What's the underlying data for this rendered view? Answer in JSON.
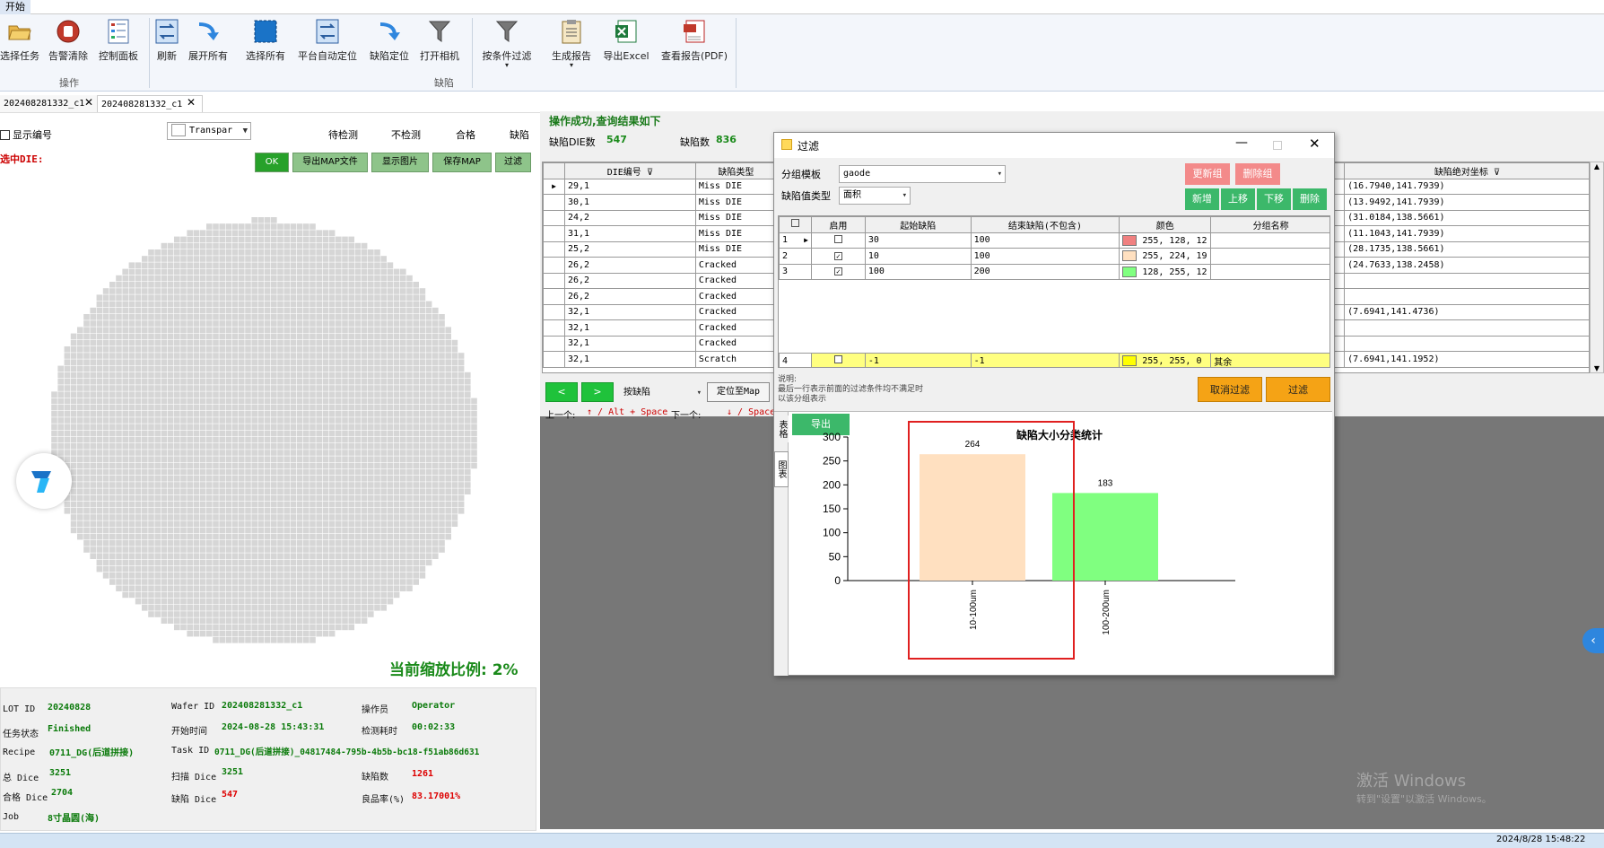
{
  "title_tab": "开始",
  "ribbon": {
    "buttons": [
      {
        "label": "选择任务",
        "icon": "folder-open-icon"
      },
      {
        "label": "告警清除",
        "icon": "stop-hand-icon"
      },
      {
        "label": "控制面板",
        "icon": "control-panel-icon"
      },
      {
        "label": "刷新",
        "icon": "refresh-icon"
      },
      {
        "label": "展开所有",
        "icon": "expand-arrow-icon"
      },
      {
        "label": "选择所有",
        "icon": "select-all-icon"
      },
      {
        "label": "平台自动定位",
        "icon": "auto-locate-icon"
      },
      {
        "label": "缺陷定位",
        "icon": "locate-arrow-icon"
      },
      {
        "label": "打开相机",
        "icon": "funnel-icon"
      },
      {
        "label": "按条件过滤",
        "icon": "filter-icon"
      },
      {
        "label": "生成报告",
        "icon": "clipboard-icon"
      },
      {
        "label": "导出Excel",
        "icon": "excel-icon"
      },
      {
        "label": "查看报告(PDF)",
        "icon": "pdf-icon"
      }
    ],
    "group_operation": "操作",
    "group_defect": "缺陷"
  },
  "doc_tabs": [
    "202408281332_c1",
    "202408281332_c1"
  ],
  "left": {
    "show_number": "显示编号",
    "combo_value": "Transpar",
    "legend": [
      "待检测",
      "不检测",
      "合格",
      "缺陷"
    ],
    "selected_die_label": "选中DIE:",
    "buttons": [
      "OK",
      "导出MAP文件",
      "显示图片",
      "保存MAP",
      "过滤"
    ],
    "zoom_text": "当前缩放比例: 2%"
  },
  "info": {
    "lot_id_label": "LOT ID",
    "lot_id": "20240828",
    "wafer_id_label": "Wafer ID",
    "wafer_id": "202408281332_c1",
    "operator_label": "操作员",
    "operator": "Operator",
    "task_status_label": "任务状态",
    "task_status": "Finished",
    "start_time_label": "开始时间",
    "start_time": "2024-08-28 15:43:31",
    "duration_label": "检测耗时",
    "duration": "00:02:33",
    "recipe_label": "Recipe",
    "recipe": "0711_DG(后道拼接)",
    "task_id_label": "Task ID",
    "task_id": "0711_DG(后道拼接)_04817484-795b-4b5b-bc18-f51ab86d631",
    "total_dice_label": "总 Dice",
    "total_dice": "3251",
    "scan_dice_label": "扫描 Dice",
    "scan_dice": "3251",
    "defect_count_label": "缺陷数",
    "defect_count": "1261",
    "pass_dice_label": "合格 Dice",
    "pass_dice": "2704",
    "defect_dice_label": "缺陷 Dice",
    "defect_dice": "547",
    "yield_label": "良品率(%)",
    "yield": "83.17001%",
    "job_label": "Job",
    "job": "8寸晶圆(海)"
  },
  "result": {
    "message": "操作成功,查询结果如下",
    "defect_die_label": "缺陷DIE数",
    "defect_die": "547",
    "defect_num_label": "缺陷数",
    "defect_num": "836"
  },
  "table": {
    "headers": [
      "DIE编号",
      "缺陷类型",
      "缺陷绝对坐标"
    ],
    "rows": [
      {
        "die": "29,1",
        "type": "Miss DIE",
        "coord": "(16.7940,141.7939)"
      },
      {
        "die": "30,1",
        "type": "Miss DIE",
        "coord": "(13.9492,141.7939)"
      },
      {
        "die": "24,2",
        "type": "Miss DIE",
        "coord": "(31.0184,138.5661)"
      },
      {
        "die": "31,1",
        "type": "Miss DIE",
        "coord": "(11.1043,141.7939)"
      },
      {
        "die": "25,2",
        "type": "Miss DIE",
        "coord": "(28.1735,138.5661)"
      },
      {
        "die": "26,2",
        "type": "Cracked",
        "coord": "(24.7633,138.2458)"
      },
      {
        "die": "26,2",
        "type": "Cracked",
        "coord": ""
      },
      {
        "die": "26,2",
        "type": "Cracked",
        "coord": ""
      },
      {
        "die": "32,1",
        "type": "Cracked",
        "coord": "(7.6941,141.4736)"
      },
      {
        "die": "32,1",
        "type": "Cracked",
        "coord": ""
      },
      {
        "die": "32,1",
        "type": "Cracked",
        "coord": ""
      },
      {
        "die": "32,1",
        "type": "Scratch",
        "coord": "(7.6941,141.1952)"
      }
    ]
  },
  "nav": {
    "combo": "按缺陷",
    "locate_btn": "定位至Map",
    "prev_label": "上一个:",
    "prev_key": "↑ / Alt + Space",
    "next_label": "下一个:",
    "next_key": "↓ / Space"
  },
  "dialog": {
    "title": "过滤",
    "group_template_label": "分组模板",
    "group_template": "gaode",
    "value_type_label": "缺陷值类型",
    "value_type": "面积",
    "btn_update": "更新组",
    "btn_delete_group": "删除组",
    "btn_add": "新增",
    "btn_up": "上移",
    "btn_down": "下移",
    "btn_delete": "删除",
    "headers": [
      "启用",
      "起始缺陷",
      "结束缺陷(不包含)",
      "颜色",
      "分组名称"
    ],
    "rows": [
      {
        "idx": "1",
        "enabled": false,
        "start": "30",
        "end": "100",
        "color": "#f08080",
        "rgb": "255, 128, 12",
        "name": ""
      },
      {
        "idx": "2",
        "enabled": true,
        "start": "10",
        "end": "100",
        "color": "#ffe0c0",
        "rgb": "255, 224, 19",
        "name": ""
      },
      {
        "idx": "3",
        "enabled": true,
        "start": "100",
        "end": "200",
        "color": "#80ff80",
        "rgb": "128, 255, 12",
        "name": ""
      }
    ],
    "last_row": {
      "idx": "4",
      "enabled": false,
      "start": "-1",
      "end": "-1",
      "color": "#ffff00",
      "rgb": "255, 255, 0",
      "name": "其余"
    },
    "note_line1": "说明:",
    "note_line2": "最后一行表示前面的过滤条件均不满足时",
    "note_line3": "以该分组表示",
    "btn_cancel": "取消过滤",
    "btn_filter": "过滤",
    "side_tab1": "表格",
    "side_tab2": "图表",
    "btn_export": "导出"
  },
  "chart_data": {
    "type": "bar",
    "title": "缺陷大小分类统计",
    "categories": [
      "10-100um",
      "100-200um"
    ],
    "values": [
      264,
      183
    ],
    "colors": [
      "#ffe0c0",
      "#80ff80"
    ],
    "ylim": [
      0,
      300
    ],
    "yticks": [
      0,
      50,
      100,
      150,
      200,
      250,
      300
    ]
  },
  "watermark": {
    "line1": "激活 Windows",
    "line2": "转到\"设置\"以激活 Windows。"
  },
  "taskbar": {
    "datetime": "2024/8/28 15:48:22"
  }
}
